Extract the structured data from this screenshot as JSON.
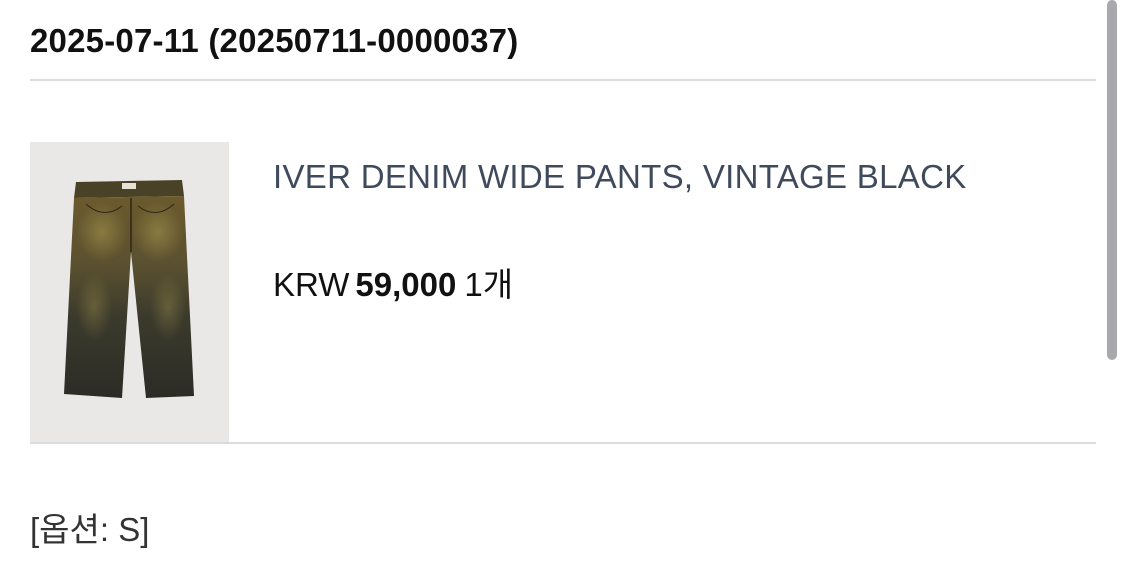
{
  "order": {
    "header": "2025-07-11 (20250711-0000037)"
  },
  "product": {
    "image_alt": "wide-leg vintage black denim pants",
    "name": "IVER DENIM WIDE PANTS, VINTAGE BLACK",
    "currency": "KRW",
    "price": "59,000",
    "quantity": "1개",
    "option": "[옵션: S]"
  },
  "colors": {
    "product_name": "#3f4a5c",
    "divider": "#dcdcdc",
    "scrollbar": "#a9a9ad"
  }
}
